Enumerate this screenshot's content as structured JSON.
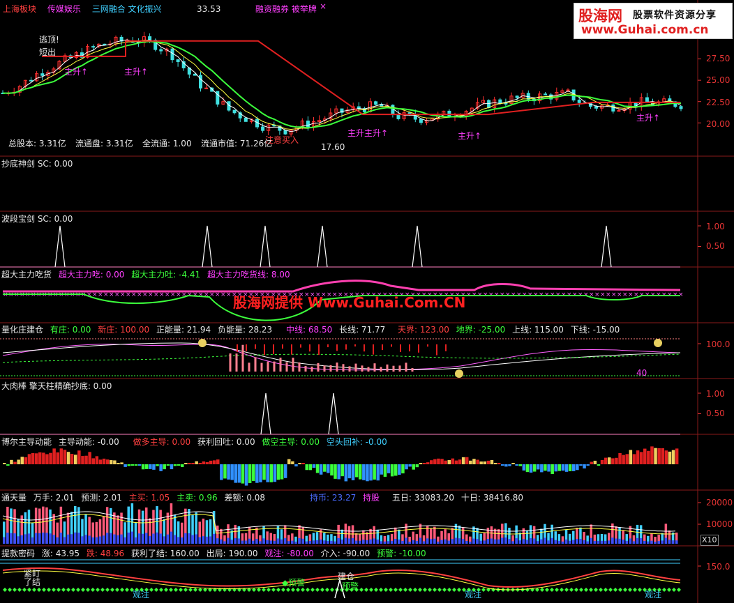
{
  "header": {
    "items": [
      {
        "text": "上海板块",
        "color": "#ff4040"
      },
      {
        "text": "传媒娱乐",
        "color": "#ff40ff"
      },
      {
        "text": "三网融合 文化振兴",
        "color": "#40d0ff"
      },
      {
        "text": "融资融券 被举牌",
        "color": "#ff40ff"
      }
    ],
    "close_mark": "×"
  },
  "logo": {
    "brand": "股海网",
    "tagline": "股票软件资源分享",
    "url": "www.Guhai.com.cn"
  },
  "watermark": "股海网提供 Www.Guhai.Com.CN",
  "kline": {
    "high_label": "33.53",
    "low_label": "17.60",
    "annotations": [
      {
        "text": "逃顶!",
        "color": "#e6e6e6"
      },
      {
        "text": "短出",
        "color": "#e6e6e6"
      },
      {
        "text": "注意买入",
        "color": "#ff4040"
      },
      {
        "text": "主升↑",
        "color": "#ff40ff"
      },
      {
        "text": "主升↑",
        "color": "#ff40ff"
      },
      {
        "text": "主升主升↑",
        "color": "#ff40ff"
      },
      {
        "text": "主升↑",
        "color": "#ff40ff"
      },
      {
        "text": "主升↑",
        "color": "#ff40ff"
      }
    ],
    "info": [
      {
        "text": "总股本: 3.31亿"
      },
      {
        "text": "流通盘: 3.31亿"
      },
      {
        "text": "全流通: 1.00"
      },
      {
        "text": "流通市值: 71.26亿"
      }
    ],
    "yticks": [
      "27.50",
      "25.00",
      "22.50",
      "20.00"
    ]
  },
  "panels": [
    {
      "id": "p1",
      "labels": [
        {
          "text": "抄底神剑  SC: 0.00",
          "color": "#e6e6e6"
        }
      ],
      "yticks": []
    },
    {
      "id": "p2",
      "labels": [
        {
          "text": "波段宝剑  SC: 0.00",
          "color": "#e6e6e6"
        }
      ],
      "yticks": [
        "1.00",
        "0.50"
      ]
    },
    {
      "id": "p3",
      "labels": [
        {
          "text": "超大主力吃货",
          "color": "#e6e6e6"
        },
        {
          "text": "超大主力吃: 0.00",
          "color": "#ff40ff"
        },
        {
          "text": "超大主力吐: -4.41",
          "color": "#3cff3c"
        },
        {
          "text": "超大主力吃货线: 8.00",
          "color": "#ff40ff"
        }
      ],
      "yticks": []
    },
    {
      "id": "p4",
      "labels": [
        {
          "text": "量化庄建仓",
          "color": "#e6e6e6"
        },
        {
          "text": "有庄: 0.00",
          "color": "#3cff3c"
        },
        {
          "text": "新庄: 100.00",
          "color": "#ff4040"
        },
        {
          "text": "正能量: 21.94",
          "color": "#e6e6e6"
        },
        {
          "text": "负能量: 28.23",
          "color": "#e6e6e6"
        },
        {
          "text": "中线: 68.50",
          "color": "#ff40ff"
        },
        {
          "text": "长线: 71.77",
          "color": "#e6e6e6"
        },
        {
          "text": "天界: 123.00",
          "color": "#ff4040"
        },
        {
          "text": "地界: -25.00",
          "color": "#3cff3c"
        },
        {
          "text": "上线: 115.00",
          "color": "#e6e6e6"
        },
        {
          "text": "下线: -15.00",
          "color": "#e6e6e6"
        }
      ],
      "yticks": [
        "100.0"
      ],
      "mark": "40"
    },
    {
      "id": "p5",
      "labels": [
        {
          "text": "大肉棒  擎天柱精确抄底: 0.00",
          "color": "#e6e6e6"
        }
      ],
      "yticks": [
        "1.00",
        "0.50"
      ]
    },
    {
      "id": "p6",
      "labels": [
        {
          "text": "博尔主导动能",
          "color": "#e6e6e6"
        },
        {
          "text": "主导动能: -0.00",
          "color": "#e6e6e6"
        },
        {
          "text": "做多主导: 0.00",
          "color": "#ff4040"
        },
        {
          "text": "获利回吐: 0.00",
          "color": "#e6e6e6"
        },
        {
          "text": "做空主导: 0.00",
          "color": "#3cff3c"
        },
        {
          "text": "空头回补: -0.00",
          "color": "#40d0ff"
        }
      ],
      "yticks": []
    },
    {
      "id": "p7",
      "labels": [
        {
          "text": "通天量",
          "color": "#e6e6e6"
        },
        {
          "text": "万手: 2.01",
          "color": "#e6e6e6"
        },
        {
          "text": "预测: 2.01",
          "color": "#e6e6e6"
        },
        {
          "text": "主买: 1.05",
          "color": "#ff4040"
        },
        {
          "text": "主卖: 0.96",
          "color": "#3cff3c"
        },
        {
          "text": "差额: 0.08",
          "color": "#e6e6e6"
        },
        {
          "text": "持币: 23.27",
          "color": "#4a6bff"
        },
        {
          "text": "持股",
          "color": "#ff40ff"
        },
        {
          "text": "五日: 33083.20",
          "color": "#e6e6e6"
        },
        {
          "text": "十日: 38416.80",
          "color": "#e6e6e6"
        }
      ],
      "yticks": [
        "20000",
        "10000"
      ],
      "unit": "X10"
    },
    {
      "id": "p8",
      "labels": [
        {
          "text": "提款密码",
          "color": "#e6e6e6"
        },
        {
          "text": "涨: 43.95",
          "color": "#e6e6e6"
        },
        {
          "text": "跌: 48.96",
          "color": "#ff4040"
        },
        {
          "text": "获利了结: 160.00",
          "color": "#e6e6e6"
        },
        {
          "text": "出局: 190.00",
          "color": "#e6e6e6"
        },
        {
          "text": "观注: -80.00",
          "color": "#ff40ff"
        },
        {
          "text": "介入: -90.00",
          "color": "#e6e6e6"
        },
        {
          "text": "预警: -10.00",
          "color": "#3cff3c"
        }
      ],
      "yticks": [
        "150.0"
      ],
      "annotations": [
        {
          "text": "紧盯",
          "color": "#e6e6e6"
        },
        {
          "text": "了结",
          "color": "#e6e6e6"
        },
        {
          "text": "◆预警",
          "color": "#3cff3c"
        },
        {
          "text": "建仓",
          "color": "#e6e6e6"
        },
        {
          "text": "预警",
          "color": "#3cff3c"
        },
        {
          "text": "观注",
          "color": "#40d0ff"
        },
        {
          "text": "观注",
          "color": "#40d0ff"
        },
        {
          "text": "观注",
          "color": "#40d0ff"
        }
      ]
    }
  ],
  "chart_data": {
    "type": "line",
    "title": "",
    "price_axis": {
      "ylim": [
        17.0,
        34.0
      ],
      "ticks": [
        27.5,
        25.0,
        22.5,
        20.0
      ]
    },
    "price_trend": [
      [
        0,
        23.5
      ],
      [
        10,
        24.5
      ],
      [
        20,
        26.0
      ],
      [
        30,
        27.0
      ],
      [
        40,
        28.0
      ],
      [
        50,
        29.0
      ],
      [
        60,
        29.5
      ],
      [
        70,
        29.8
      ],
      [
        80,
        29.3
      ],
      [
        90,
        28.0
      ],
      [
        100,
        25.5
      ],
      [
        110,
        23.5
      ],
      [
        120,
        21.5
      ],
      [
        130,
        20.5
      ],
      [
        140,
        19.5
      ],
      [
        150,
        19.2
      ],
      [
        160,
        19.8
      ],
      [
        170,
        20.5
      ],
      [
        180,
        21.3
      ],
      [
        190,
        21.8
      ],
      [
        200,
        22.0
      ],
      [
        210,
        20.8
      ],
      [
        220,
        20.5
      ],
      [
        230,
        20.7
      ],
      [
        240,
        21.2
      ],
      [
        250,
        21.8
      ],
      [
        260,
        22.4
      ],
      [
        270,
        22.8
      ],
      [
        280,
        23.0
      ],
      [
        290,
        23.2
      ],
      [
        300,
        23.4
      ],
      [
        310,
        22.0
      ],
      [
        320,
        21.9
      ],
      [
        330,
        22.1
      ],
      [
        340,
        22.4
      ],
      [
        350,
        22.3
      ],
      [
        360,
        22.2
      ]
    ],
    "series": [
      {
        "name": "长线",
        "values": [
          71.77
        ]
      },
      {
        "name": "中线",
        "values": [
          68.5
        ]
      }
    ],
    "ylabel": ""
  }
}
